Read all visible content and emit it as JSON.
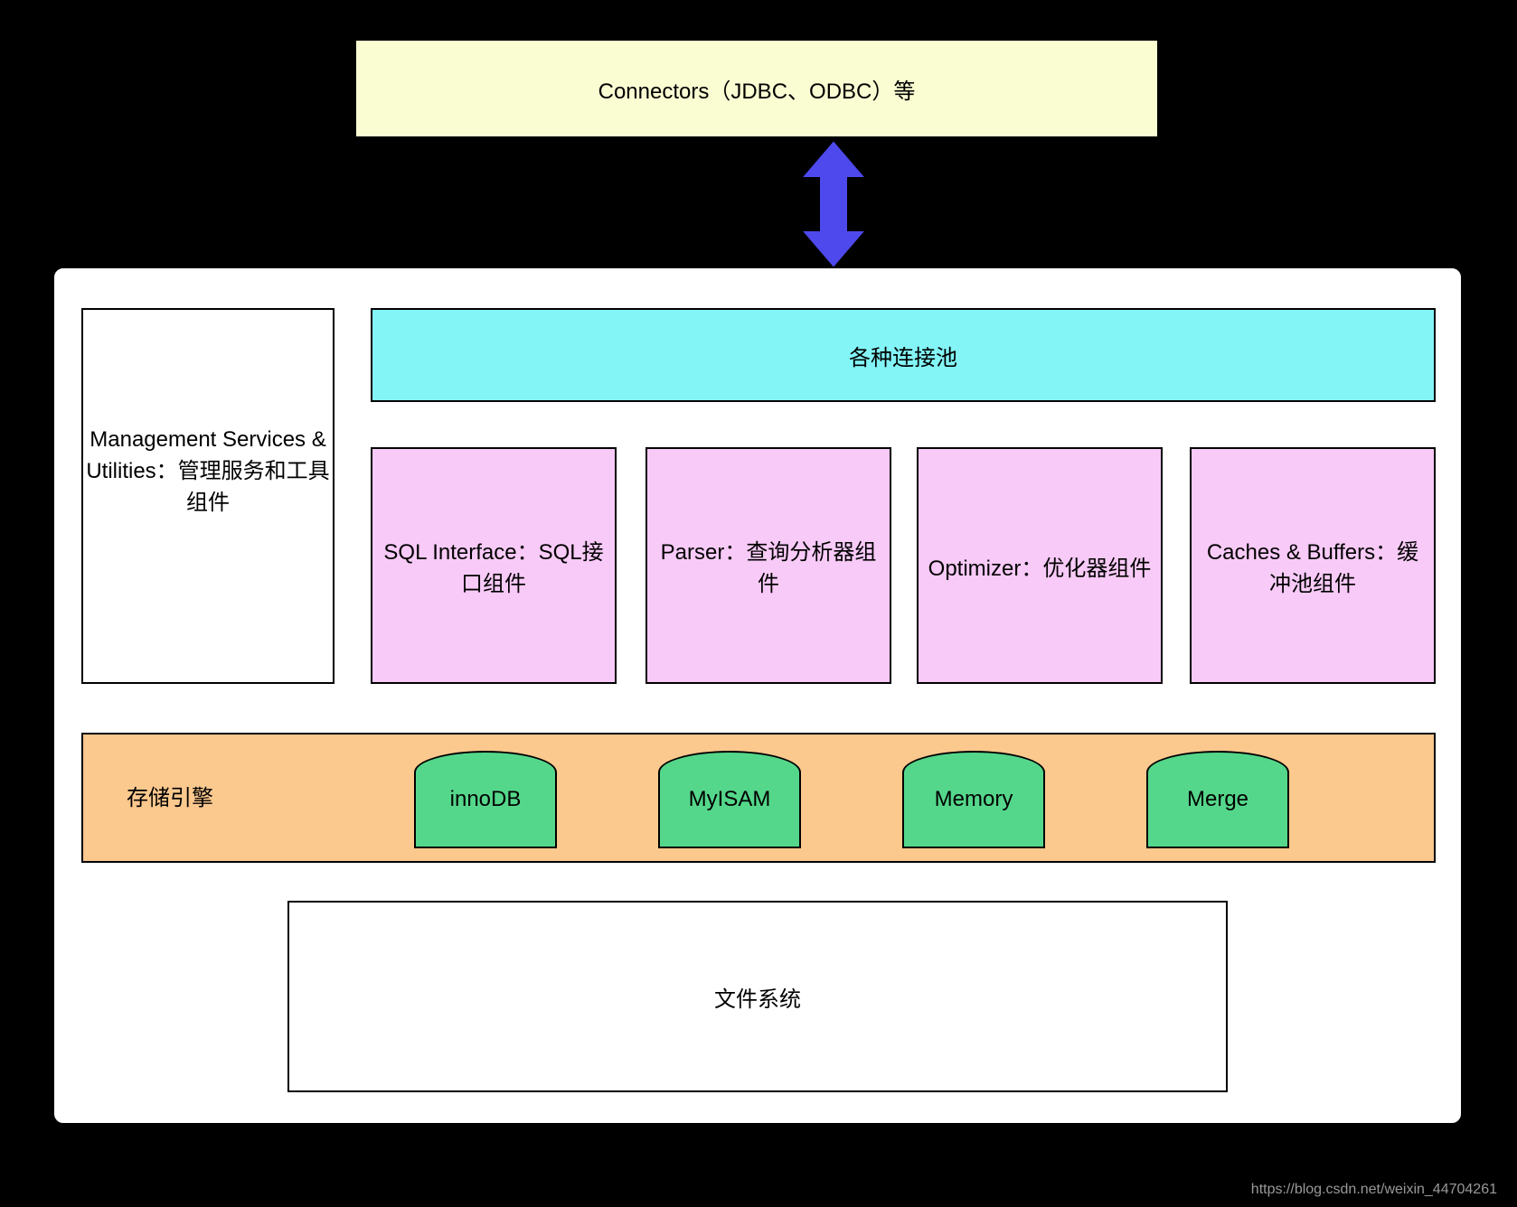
{
  "connectors": {
    "label": "Connectors（JDBC、ODBC）等"
  },
  "server": {
    "management": {
      "label": "Management Services & Utilities：管理服务和工具组件"
    },
    "pool": {
      "label": "各种连接池"
    },
    "components": [
      {
        "label": "SQL Interface：SQL接口组件"
      },
      {
        "label": "Parser：查询分析器组件"
      },
      {
        "label": "Optimizer：优化器组件"
      },
      {
        "label": "Caches & Buffers：缓冲池组件"
      }
    ],
    "engines": {
      "label": "存储引擎",
      "items": [
        "innoDB",
        "MyISAM",
        "Memory",
        "Merge"
      ]
    },
    "filesystem": {
      "label": "文件系统"
    }
  },
  "watermark": "https://blog.csdn.net/weixin_44704261"
}
